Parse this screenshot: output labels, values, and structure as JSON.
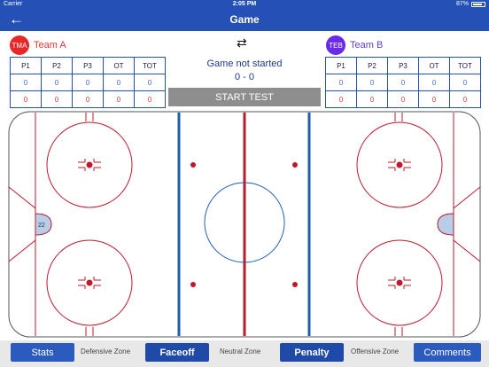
{
  "status_bar": {
    "carrier": "Carrier",
    "time": "2:05 PM",
    "battery": "87%",
    "battery_level": 0.87
  },
  "nav": {
    "back_icon": "arrow-left-icon",
    "title": "Game"
  },
  "team_a": {
    "badge": "TMA",
    "name": "Team A",
    "color": "#e8272a"
  },
  "team_b": {
    "badge": "TEB",
    "name": "Team B",
    "color": "#6a2be8"
  },
  "swap_icon": "swap-arrows-icon",
  "score_table": {
    "headers": [
      "P1",
      "P2",
      "P3",
      "OT",
      "TOT"
    ],
    "team_a_rows": [
      [
        "0",
        "0",
        "0",
        "0",
        "0"
      ],
      [
        "0",
        "0",
        "0",
        "0",
        "0"
      ]
    ],
    "team_b_rows": [
      [
        "0",
        "0",
        "0",
        "0",
        "0"
      ],
      [
        "0",
        "0",
        "0",
        "0",
        "0"
      ]
    ]
  },
  "game": {
    "status": "Game not started",
    "score": "0 - 0",
    "start_button": "START TEST"
  },
  "rink": {
    "left_goalie_number": "22"
  },
  "toolbar": {
    "stats": "Stats",
    "defensive_zone": "Defensive Zone",
    "faceoff": "Faceoff",
    "neutral_zone": "Neutral Zone",
    "penalty": "Penalty",
    "offensive_zone": "Offensive Zone",
    "comments": "Comments"
  },
  "colors": {
    "primary": "#2550b5",
    "red_line": "#c0182a",
    "blue_line": "#1f5fb0",
    "crease": "#b8cde8"
  }
}
